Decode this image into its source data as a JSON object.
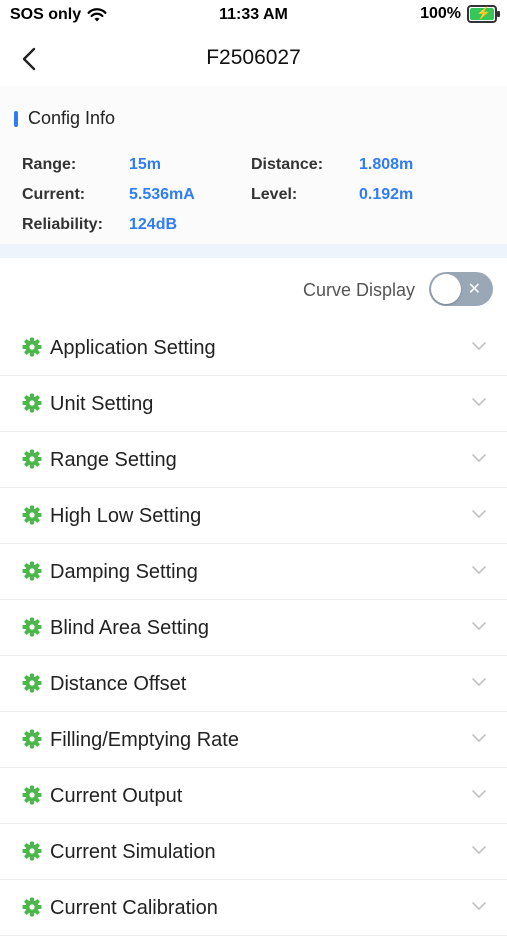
{
  "status_bar": {
    "carrier": "SOS only",
    "time": "11:33 AM",
    "battery": "100%"
  },
  "nav": {
    "title": "F2506027"
  },
  "config": {
    "title": "Config Info",
    "range_label": "Range:",
    "range_value": "15m",
    "distance_label": "Distance:",
    "distance_value": "1.808m",
    "current_label": "Current:",
    "current_value": "5.536mA",
    "level_label": "Level:",
    "level_value": "0.192m",
    "reliability_label": "Reliability:",
    "reliability_value": "124dB"
  },
  "curve": {
    "label": "Curve Display",
    "enabled": false
  },
  "settings": [
    {
      "label": "Application Setting"
    },
    {
      "label": "Unit Setting"
    },
    {
      "label": "Range Setting"
    },
    {
      "label": "High Low Setting"
    },
    {
      "label": "Damping Setting"
    },
    {
      "label": "Blind Area Setting"
    },
    {
      "label": "Distance Offset"
    },
    {
      "label": "Filling/Emptying Rate"
    },
    {
      "label": "Current Output"
    },
    {
      "label": "Current Simulation"
    },
    {
      "label": "Current Calibration"
    }
  ],
  "colors": {
    "accent": "#2f7cf6",
    "gear": "#4cb84a",
    "toggle_off": "#9aa8b6"
  }
}
